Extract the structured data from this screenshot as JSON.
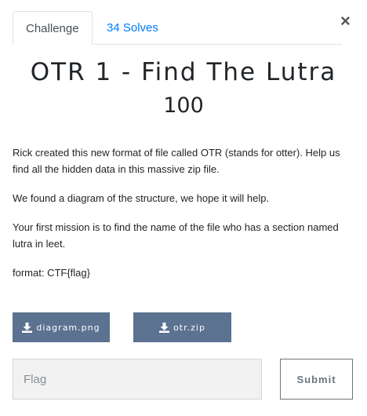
{
  "tabs": [
    {
      "label": "Challenge",
      "active": true
    },
    {
      "label": "34 Solves",
      "active": false
    }
  ],
  "close_label": "×",
  "challenge": {
    "title": "OTR 1 - Find The Lutra",
    "points": "100",
    "description": [
      "Rick created this new format of file called OTR (stands for otter). Help us find all the hidden data in this massive zip file.",
      "We found a diagram of the structure, we hope it will help.",
      "Your first mission is to find the name of the file who has a section named lutra in leet.",
      "format: CTF{flag}"
    ]
  },
  "files": [
    {
      "label": "diagram.png",
      "icon": "download-icon"
    },
    {
      "label": "otr.zip",
      "icon": "download-icon"
    }
  ],
  "flag_input": {
    "placeholder": "Flag",
    "value": ""
  },
  "submit_label": "Submit",
  "colors": {
    "file_button": "#5b7290",
    "tab_link": "#007bff"
  }
}
